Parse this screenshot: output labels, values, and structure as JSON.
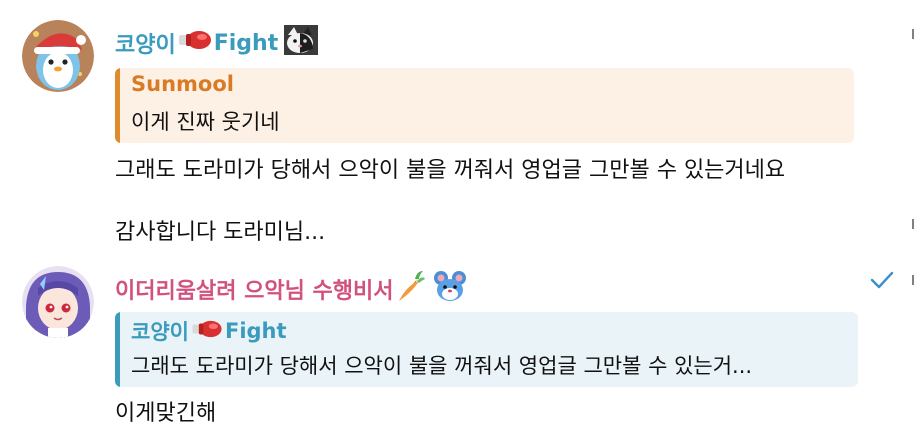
{
  "messages": [
    {
      "sender": {
        "name": "코양이",
        "suffix": "Fight",
        "emojis": [
          "boxing-glove-icon",
          "cat-photo-icon"
        ]
      },
      "reply": {
        "name": "Sunmool",
        "text": "이게 진짜 웃기네"
      },
      "lines": [
        "그래도 도라미가 당해서 으악이 불을 꺼줘서 영업글 그만볼 수 있는거네요",
        "감사합니다 도라미님..."
      ]
    },
    {
      "sender": {
        "name": "이더리움살려 으악님 수행비서",
        "emojis": [
          "carrot-icon",
          "blue-mouse-icon"
        ]
      },
      "reply": {
        "name": "코양이",
        "suffix": "Fight",
        "text": "그래도 도라미가 당해서 으악이 불을 꺼줘서 영업글 그만볼 수 있는거..."
      },
      "lines": [
        "이게맞긴해"
      ],
      "status": "read-checkmark-icon"
    }
  ],
  "colors": {
    "name1": "#3a9bbd",
    "name2": "#d2527f",
    "reply1_bar": "#e08a2e",
    "reply1_bg": "#fdf1e6",
    "reply1_name": "#d97a25",
    "reply2_bar": "#3a9bbd",
    "reply2_bg": "#eaf4f8",
    "reply2_name": "#3a9bbd",
    "check": "#3a8fd0"
  }
}
